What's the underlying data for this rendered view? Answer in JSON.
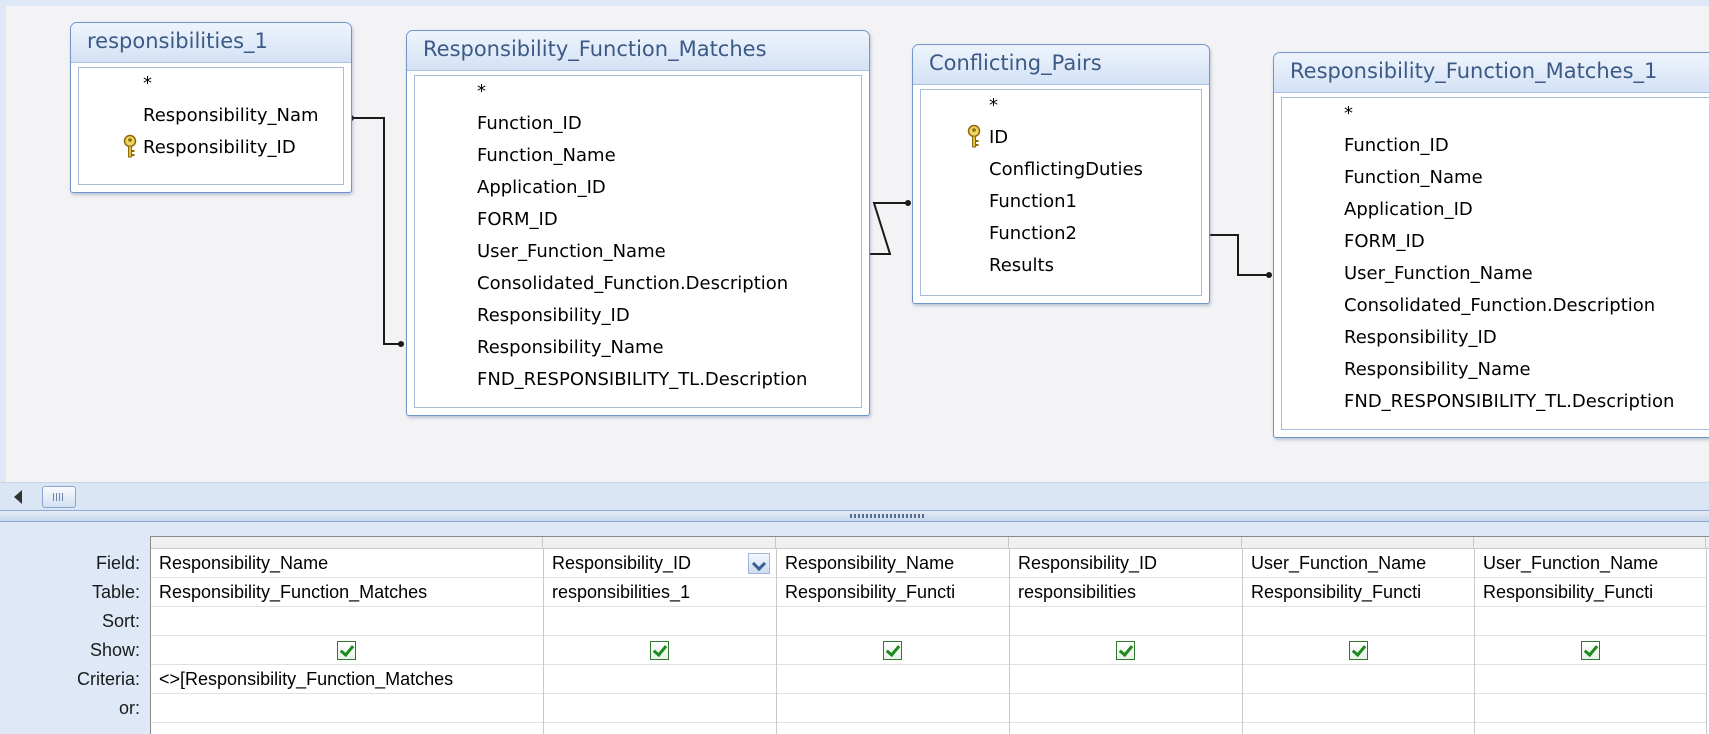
{
  "field_lists": [
    {
      "title": "responsibilities_1",
      "fields": [
        {
          "name": "*",
          "key": false
        },
        {
          "name": "Responsibility_Nam",
          "key": false
        },
        {
          "name": "Responsibility_ID",
          "key": true
        }
      ]
    },
    {
      "title": "Responsibility_Function_Matches",
      "fields": [
        {
          "name": "*",
          "key": false
        },
        {
          "name": "Function_ID",
          "key": false
        },
        {
          "name": "Function_Name",
          "key": false
        },
        {
          "name": "Application_ID",
          "key": false
        },
        {
          "name": "FORM_ID",
          "key": false
        },
        {
          "name": "User_Function_Name",
          "key": false
        },
        {
          "name": "Consolidated_Function.Description",
          "key": false
        },
        {
          "name": "Responsibility_ID",
          "key": false
        },
        {
          "name": "Responsibility_Name",
          "key": false
        },
        {
          "name": "FND_RESPONSIBILITY_TL.Description",
          "key": false
        }
      ]
    },
    {
      "title": "Conflicting_Pairs",
      "fields": [
        {
          "name": "*",
          "key": false
        },
        {
          "name": "ID",
          "key": true
        },
        {
          "name": "ConflictingDuties",
          "key": false
        },
        {
          "name": "Function1",
          "key": false
        },
        {
          "name": "Function2",
          "key": false
        },
        {
          "name": "Results",
          "key": false
        }
      ]
    },
    {
      "title": "Responsibility_Function_Matches_1",
      "fields": [
        {
          "name": "*",
          "key": false
        },
        {
          "name": "Function_ID",
          "key": false
        },
        {
          "name": "Function_Name",
          "key": false
        },
        {
          "name": "Application_ID",
          "key": false
        },
        {
          "name": "FORM_ID",
          "key": false
        },
        {
          "name": "User_Function_Name",
          "key": false
        },
        {
          "name": "Consolidated_Function.Description",
          "key": false
        },
        {
          "name": "Responsibility_ID",
          "key": false
        },
        {
          "name": "Responsibility_Name",
          "key": false
        },
        {
          "name": "FND_RESPONSIBILITY_TL.Description",
          "key": false
        }
      ]
    }
  ],
  "design_grid": {
    "row_labels": [
      "Field:",
      "Table:",
      "Sort:",
      "Show:",
      "Criteria:",
      "or:"
    ],
    "columns": [
      {
        "field": "Responsibility_Name",
        "table": "Responsibility_Function_Matches",
        "sort": "",
        "show": true,
        "criteria": "<>[Responsibility_Function_Matches",
        "or": "",
        "dropdown": false
      },
      {
        "field": "Responsibility_ID",
        "table": "responsibilities_1",
        "sort": "",
        "show": true,
        "criteria": "",
        "or": "",
        "dropdown": true
      },
      {
        "field": "Responsibility_Name",
        "table": "Responsibility_Functi",
        "sort": "",
        "show": true,
        "criteria": "",
        "or": "",
        "dropdown": false
      },
      {
        "field": "Responsibility_ID",
        "table": "responsibilities",
        "sort": "",
        "show": true,
        "criteria": "",
        "or": "",
        "dropdown": false
      },
      {
        "field": "User_Function_Name",
        "table": "Responsibility_Functi",
        "sort": "",
        "show": true,
        "criteria": "",
        "or": "",
        "dropdown": false
      },
      {
        "field": "User_Function_Name",
        "table": "Responsibility_Functi",
        "sort": "",
        "show": true,
        "criteria": "",
        "or": "",
        "dropdown": false
      }
    ]
  },
  "colors": {
    "pane_background": "#f3f3f5",
    "table_title_text": "#3c5a86",
    "table_border": "#6f95c9",
    "grid_background": "#dfe8f6",
    "checkbox_check": "#1c8a1c"
  },
  "icons": {
    "primary_key": "key-icon",
    "show_checkbox": "checked-checkbox-icon",
    "dropdown": "chevron-down-icon",
    "scroll_left": "scroll-left-arrow-icon"
  }
}
